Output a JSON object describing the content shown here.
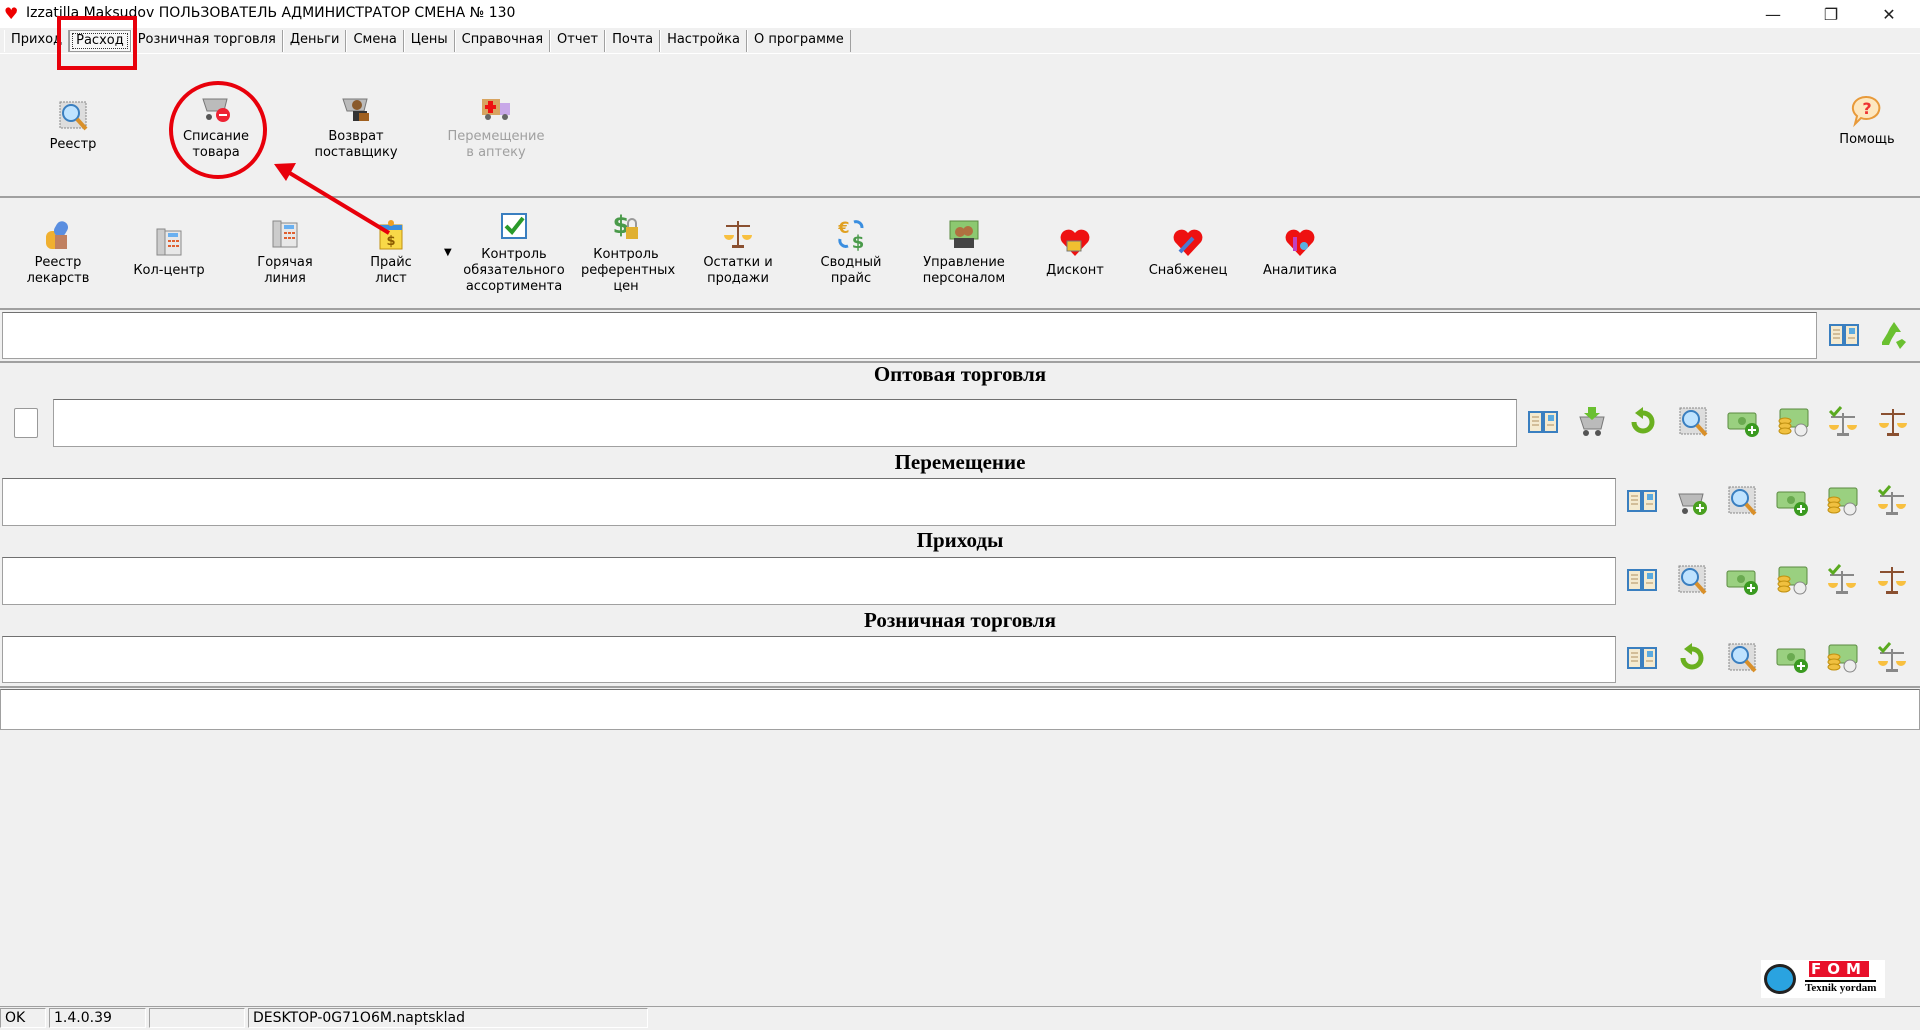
{
  "window": {
    "title": "Izzatilla Maksudov ПОЛЬЗОВАТЕЛЬ АДМИНИСТРАТОР СМЕНА № 130",
    "minimize": "—",
    "restore": "❐",
    "close": "✕"
  },
  "tabs": [
    {
      "label": "Приход"
    },
    {
      "label": "Расход",
      "active": true
    },
    {
      "label": "Розничная торговля"
    },
    {
      "label": "Деньги"
    },
    {
      "label": "Смена"
    },
    {
      "label": "Цены"
    },
    {
      "label": "Справочная"
    },
    {
      "label": "Отчет"
    },
    {
      "label": "Почта"
    },
    {
      "label": "Настройка"
    },
    {
      "label": "О программе"
    }
  ],
  "ribbon1": {
    "items": [
      {
        "label": "Реестр",
        "icon": "magnifier-icon"
      },
      {
        "label": "Списание товара",
        "icon": "cart-remove-icon"
      },
      {
        "label": "Возврат поставщику",
        "icon": "cart-supplier-icon"
      },
      {
        "label": "Перемещение в аптеку",
        "icon": "truck-icon",
        "disabled": true
      }
    ],
    "help": {
      "label": "Помощь",
      "icon": "help-icon"
    }
  },
  "ribbon2": {
    "items": [
      {
        "label": "Реестр лекарств",
        "icon": "medicine-icon"
      },
      {
        "label": "Кол-центр",
        "icon": "phone-icon"
      },
      {
        "label": "Горячая линия",
        "icon": "phone-icon"
      },
      {
        "label": "Прайс лист",
        "icon": "price-list-icon"
      },
      {
        "label": "Контроль обязательного ассортимента",
        "icon": "checkbox-icon"
      },
      {
        "label": "Контроль референтных цен",
        "icon": "dollar-lock-icon"
      },
      {
        "label": "Остатки и продажи",
        "icon": "scales-icon"
      },
      {
        "label": "Сводный прайс",
        "icon": "currency-exchange-icon"
      },
      {
        "label": "Управление персоналом",
        "icon": "staff-icon"
      },
      {
        "label": "Дисконт",
        "icon": "heart-card-icon"
      },
      {
        "label": "Снабженец",
        "icon": "heart-supply-icon"
      },
      {
        "label": "Аналитика",
        "icon": "heart-analytics-icon"
      }
    ],
    "dropdown": "▼"
  },
  "sections": [
    {
      "title": "Оптовая торговля",
      "tools": [
        "book-icon",
        "cart-download-icon",
        "refresh-icon",
        "magnifier-icon",
        "money-add-icon",
        "money-coins-icon",
        "scales-check-icon",
        "scales-icon"
      ]
    },
    {
      "title": "Перемещение",
      "tools": [
        "book-icon",
        "cart-add-icon",
        "magnifier-icon",
        "money-add-icon",
        "money-coins-icon",
        "scales-check-icon"
      ]
    },
    {
      "title": "Приходы",
      "tools": [
        "book-icon",
        "magnifier-icon",
        "money-add-icon",
        "money-coins-icon",
        "scales-check-icon",
        "scales-icon"
      ]
    },
    {
      "title": "Розничная торговля",
      "tools": [
        "book-icon",
        "refresh-icon",
        "magnifier-icon",
        "money-add-icon",
        "money-coins-icon",
        "scales-check-icon"
      ]
    }
  ],
  "topbar_tools": [
    "book-icon",
    "recycle-icon"
  ],
  "logo": {
    "brand": "FOM",
    "caption": "Texnik yordam"
  },
  "status": {
    "state": "OK",
    "version": "1.4.0.39",
    "empty": "",
    "host": "DESKTOP-0G71O6M.naptsklad"
  },
  "annotation_color": "#e8000b"
}
